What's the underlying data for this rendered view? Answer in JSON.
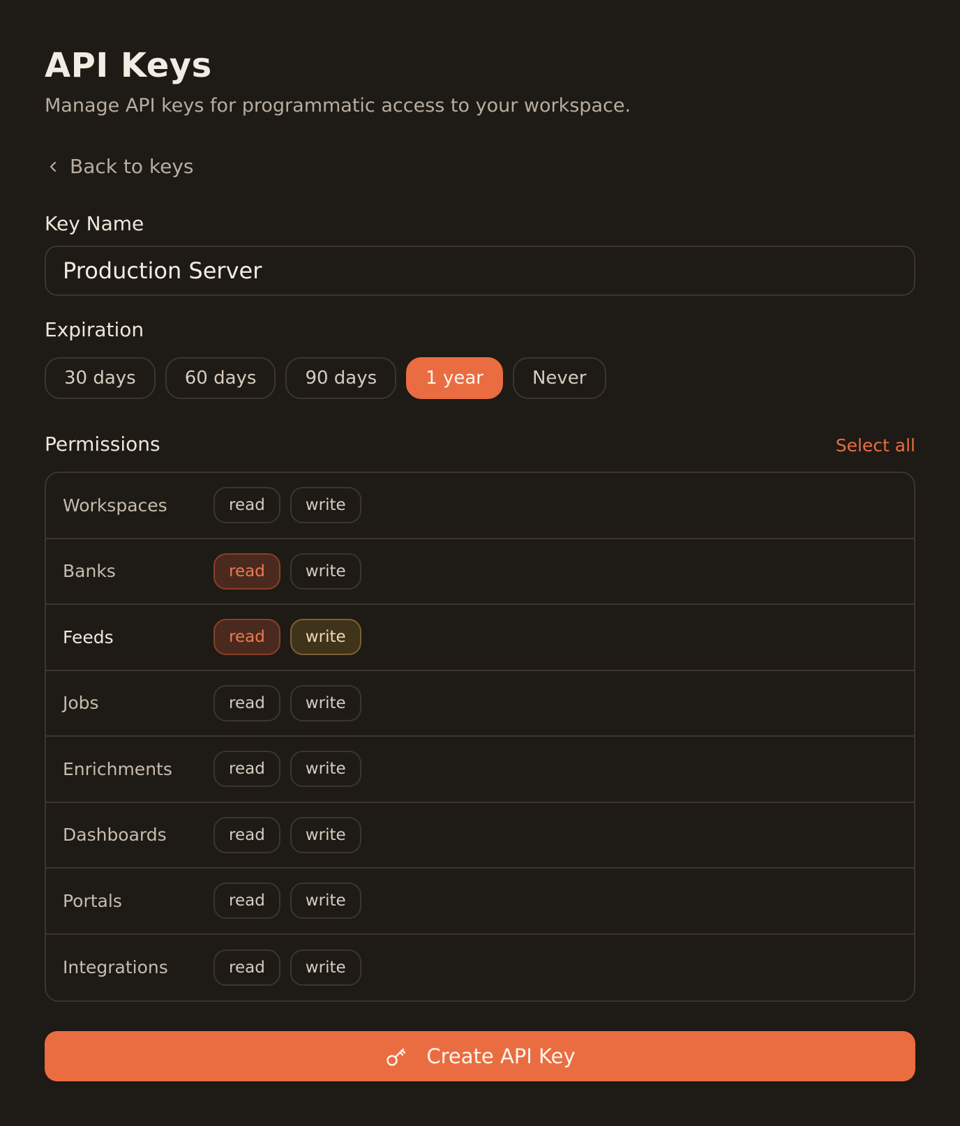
{
  "header": {
    "title": "API Keys",
    "subtitle": "Manage API keys for programmatic access to your workspace."
  },
  "back_link": {
    "label": "Back to keys",
    "icon": "chevron-left-icon"
  },
  "key_name": {
    "label": "Key Name",
    "value": "Production Server"
  },
  "expiration": {
    "label": "Expiration",
    "options": [
      "30 days",
      "60 days",
      "90 days",
      "1 year",
      "Never"
    ],
    "selected": "1 year"
  },
  "permissions": {
    "label": "Permissions",
    "select_all_label": "Select all",
    "read_label": "read",
    "write_label": "write",
    "rows": [
      {
        "name": "Workspaces",
        "read": false,
        "write": false
      },
      {
        "name": "Banks",
        "read": true,
        "write": false
      },
      {
        "name": "Feeds",
        "read": true,
        "write": true
      },
      {
        "name": "Jobs",
        "read": false,
        "write": false
      },
      {
        "name": "Enrichments",
        "read": false,
        "write": false
      },
      {
        "name": "Dashboards",
        "read": false,
        "write": false
      },
      {
        "name": "Portals",
        "read": false,
        "write": false
      },
      {
        "name": "Integrations",
        "read": false,
        "write": false
      }
    ]
  },
  "create_button": {
    "label": "Create API Key",
    "icon": "key-icon"
  },
  "colors": {
    "background": "#1e1a16",
    "accent": "#e96d41",
    "border": "#3b352e"
  }
}
